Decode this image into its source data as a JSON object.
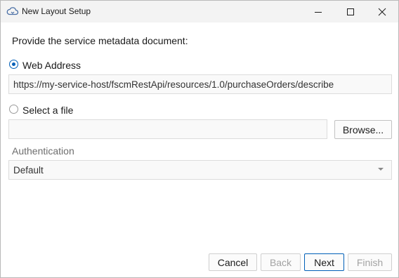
{
  "window": {
    "title": "New Layout Setup",
    "icon": "cloud-icon",
    "controls": [
      "minimize-icon",
      "maximize-icon",
      "close-icon"
    ]
  },
  "prompt": "Provide the service metadata document:",
  "source": {
    "web_address_label": "Web Address",
    "web_address_selected": true,
    "web_address_value": "https://my-service-host/fscmRestApi/resources/1.0/purchaseOrders/describe",
    "select_file_label": "Select a file",
    "select_file_selected": false,
    "file_value": "",
    "browse_label": "Browse..."
  },
  "authentication": {
    "label": "Authentication",
    "selected": "Default"
  },
  "buttons": {
    "cancel": "Cancel",
    "back": "Back",
    "next": "Next",
    "finish": "Finish"
  },
  "colors": {
    "accent": "#005fb8",
    "titlebar": "#f3f3f3",
    "disabled_text": "#a3a3a3"
  }
}
